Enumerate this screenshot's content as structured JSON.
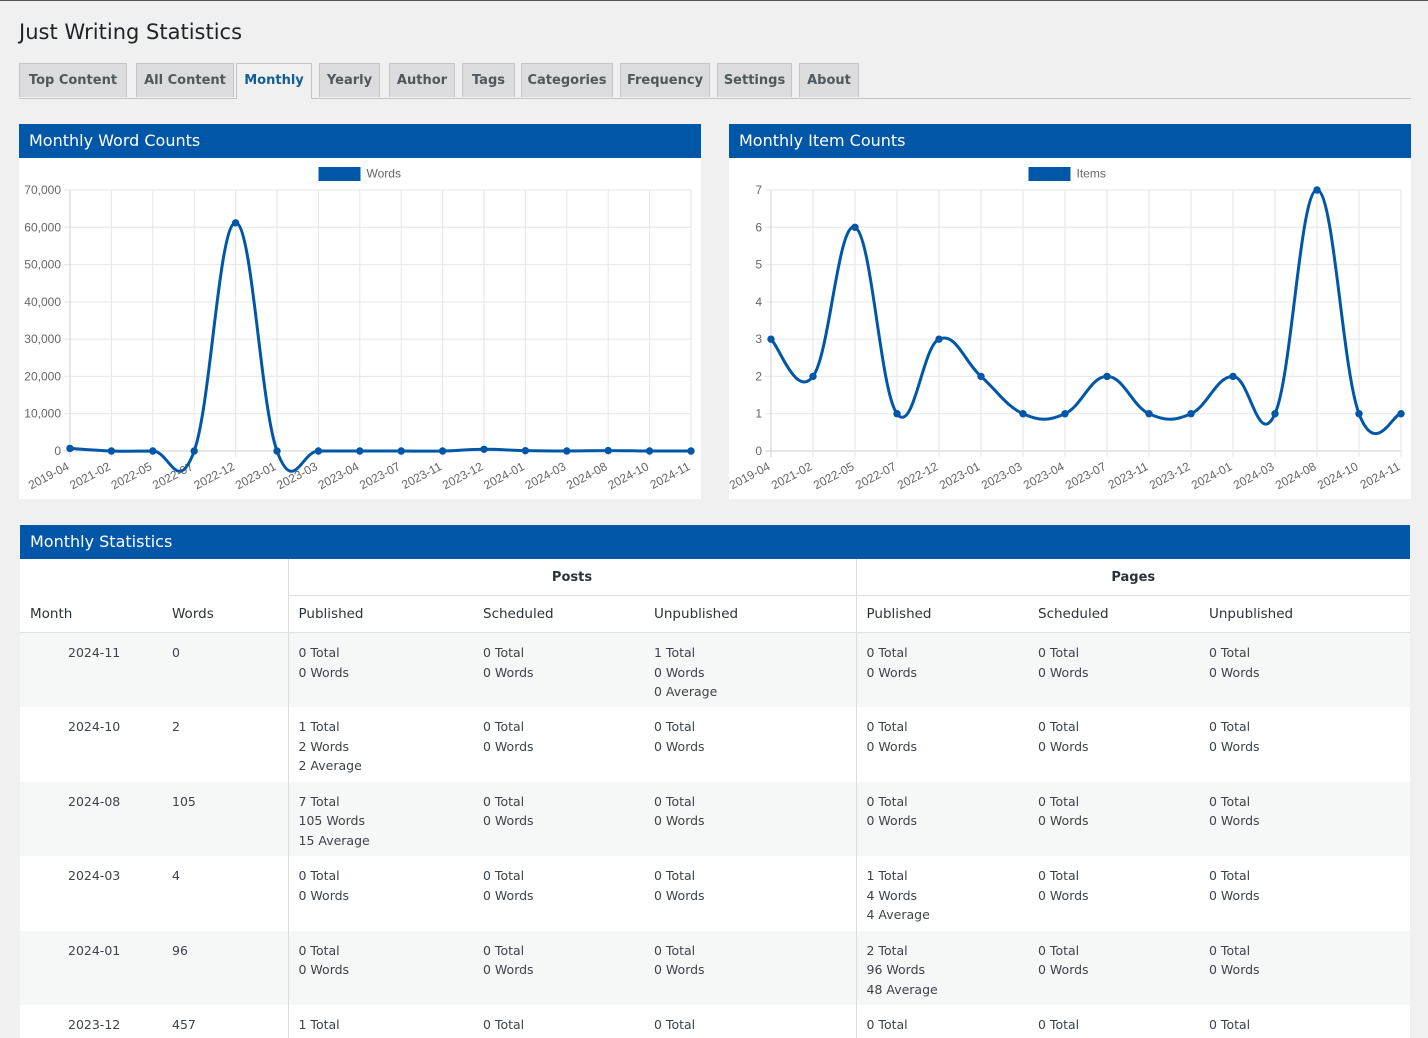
{
  "page": {
    "title": "Just Writing Statistics"
  },
  "tabs": [
    {
      "label": "Top Content",
      "active": false
    },
    {
      "label": "All Content",
      "active": false
    },
    {
      "label": "Monthly",
      "active": true
    },
    {
      "label": "Yearly",
      "active": false
    },
    {
      "label": "Author",
      "active": false
    },
    {
      "label": "Tags",
      "active": false
    },
    {
      "label": "Categories",
      "active": false
    },
    {
      "label": "Frequency",
      "active": false
    },
    {
      "label": "Settings",
      "active": false
    },
    {
      "label": "About",
      "active": false
    }
  ],
  "colors": {
    "accent": "#0057a8",
    "active_tab": "#135e96",
    "line": "#0057a8"
  },
  "chart_data": [
    {
      "type": "line",
      "title": "Monthly Word Counts",
      "legend_position": "top",
      "categories": [
        "2019-04",
        "2021-02",
        "2022-05",
        "2022-07",
        "2022-12",
        "2023-01",
        "2023-03",
        "2023-04",
        "2023-07",
        "2023-11",
        "2023-12",
        "2024-01",
        "2024-03",
        "2024-08",
        "2024-10",
        "2024-11"
      ],
      "series": [
        {
          "name": "Words",
          "values": [
            700,
            0,
            0,
            0,
            61200,
            0,
            0,
            0,
            0,
            0,
            457,
            96,
            4,
            105,
            2,
            0
          ]
        }
      ],
      "ylim": [
        0,
        70000
      ],
      "yticks": [
        "70,000",
        "60,000",
        "50,000",
        "40,000",
        "30,000",
        "20,000",
        "10,000",
        "0"
      ],
      "grid": true
    },
    {
      "type": "line",
      "title": "Monthly Item Counts",
      "legend_position": "top",
      "categories": [
        "2019-04",
        "2021-02",
        "2022-05",
        "2022-07",
        "2022-12",
        "2023-01",
        "2023-03",
        "2023-04",
        "2023-07",
        "2023-11",
        "2023-12",
        "2024-01",
        "2024-03",
        "2024-08",
        "2024-10",
        "2024-11"
      ],
      "series": [
        {
          "name": "Items",
          "values": [
            3,
            2,
            6,
            1,
            3,
            2,
            1,
            1,
            2,
            1,
            1,
            2,
            1,
            7,
            1,
            1
          ]
        }
      ],
      "ylim": [
        0,
        7
      ],
      "yticks": [
        "7",
        "6",
        "5",
        "4",
        "3",
        "2",
        "1",
        "0"
      ],
      "grid": true
    }
  ],
  "stats": {
    "title": "Monthly Statistics",
    "group_posts": "Posts",
    "group_pages": "Pages",
    "columns": {
      "month": "Month",
      "words": "Words",
      "published": "Published",
      "scheduled": "Scheduled",
      "unpublished": "Unpublished"
    },
    "rows": [
      {
        "month": "2024-11",
        "words": "0",
        "posts": [
          [
            "0 Total",
            "0 Words"
          ],
          [
            "0 Total",
            "0 Words"
          ],
          [
            "1 Total",
            "0 Words",
            "0 Average"
          ]
        ],
        "pages": [
          [
            "0 Total",
            "0 Words"
          ],
          [
            "0 Total",
            "0 Words"
          ],
          [
            "0 Total",
            "0 Words"
          ]
        ]
      },
      {
        "month": "2024-10",
        "words": "2",
        "posts": [
          [
            "1 Total",
            "2 Words",
            "2 Average"
          ],
          [
            "0 Total",
            "0 Words"
          ],
          [
            "0 Total",
            "0 Words"
          ]
        ],
        "pages": [
          [
            "0 Total",
            "0 Words"
          ],
          [
            "0 Total",
            "0 Words"
          ],
          [
            "0 Total",
            "0 Words"
          ]
        ]
      },
      {
        "month": "2024-08",
        "words": "105",
        "posts": [
          [
            "7 Total",
            "105 Words",
            "15 Average"
          ],
          [
            "0 Total",
            "0 Words"
          ],
          [
            "0 Total",
            "0 Words"
          ]
        ],
        "pages": [
          [
            "0 Total",
            "0 Words"
          ],
          [
            "0 Total",
            "0 Words"
          ],
          [
            "0 Total",
            "0 Words"
          ]
        ]
      },
      {
        "month": "2024-03",
        "words": "4",
        "posts": [
          [
            "0 Total",
            "0 Words"
          ],
          [
            "0 Total",
            "0 Words"
          ],
          [
            "0 Total",
            "0 Words"
          ]
        ],
        "pages": [
          [
            "1 Total",
            "4 Words",
            "4 Average"
          ],
          [
            "0 Total",
            "0 Words"
          ],
          [
            "0 Total",
            "0 Words"
          ]
        ]
      },
      {
        "month": "2024-01",
        "words": "96",
        "posts": [
          [
            "0 Total",
            "0 Words"
          ],
          [
            "0 Total",
            "0 Words"
          ],
          [
            "0 Total",
            "0 Words"
          ]
        ],
        "pages": [
          [
            "2 Total",
            "96 Words",
            "48 Average"
          ],
          [
            "0 Total",
            "0 Words"
          ],
          [
            "0 Total",
            "0 Words"
          ]
        ]
      },
      {
        "month": "2023-12",
        "words": "457",
        "posts": [
          [
            "1 Total"
          ],
          [
            "0 Total"
          ],
          [
            "0 Total"
          ]
        ],
        "pages": [
          [
            "0 Total"
          ],
          [
            "0 Total"
          ],
          [
            "0 Total"
          ]
        ]
      }
    ]
  }
}
